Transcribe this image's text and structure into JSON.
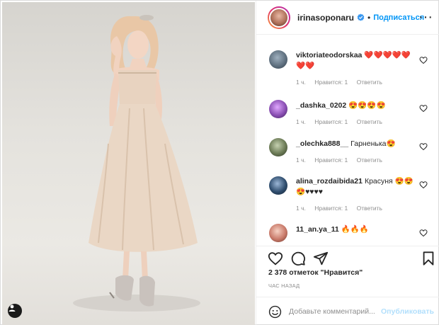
{
  "post": {
    "username": "irinasoponaru",
    "dot": "•",
    "follow_label": "Подписаться",
    "more_label": "···",
    "likes_text": "2 378 отметок \"Нравится\"",
    "time_text": "ЧАС НАЗАД"
  },
  "comments": [
    {
      "user": "viktoriateodorskaa",
      "text": "❤️❤️❤️❤️❤️❤️❤️",
      "time": "1 ч.",
      "likes": "Нравится: 1",
      "reply": "Ответить",
      "avatar_color": "#5a6b7a"
    },
    {
      "user": "_dashka_0202",
      "text": "😍😍😍😍",
      "time": "1 ч.",
      "likes": "Нравится: 1",
      "reply": "Ответить",
      "avatar_color": "#8a4fb3"
    },
    {
      "user": "_olechka888__",
      "text": "Гарненька😍",
      "time": "1 ч.",
      "likes": "Нравится: 1",
      "reply": "Ответить",
      "avatar_color": "#6b7a55"
    },
    {
      "user": "alina_rozdaibida21",
      "text": "Красуня 😍😍😍♥♥♥♥",
      "time": "1 ч.",
      "likes": "Нравится: 1",
      "reply": "Ответить",
      "avatar_color": "#2f4d6e"
    },
    {
      "user": "11_an.ya_11",
      "text": "🔥🔥🔥",
      "time": "",
      "likes": "",
      "reply": "",
      "avatar_color": "#c97a6a"
    }
  ],
  "add_comment": {
    "placeholder": "Добавьте комментарий...",
    "publish_label": "Опубликовать"
  },
  "icons": {
    "heart": "heart-icon",
    "comment": "comment-icon",
    "share": "share-icon",
    "save": "bookmark-icon",
    "smile": "emoji-icon",
    "verified": "verified-badge-icon",
    "user_tag": "user-tag-icon"
  },
  "colors": {
    "accent": "#0095f6",
    "publish_disabled": "#b2dffc",
    "muted": "#8e8e8e"
  }
}
